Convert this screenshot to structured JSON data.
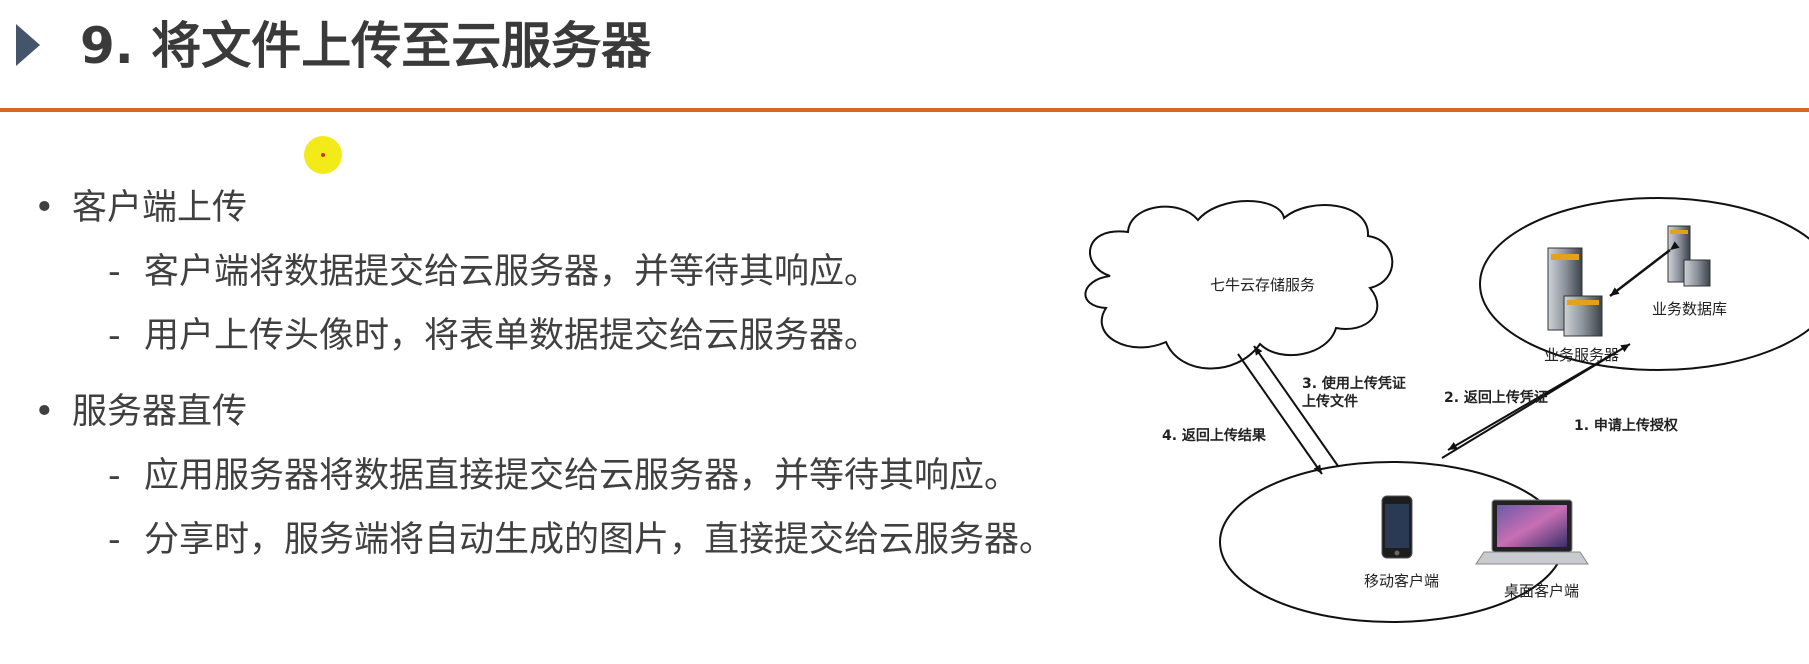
{
  "title": "9. 将文件上传至云服务器",
  "colors": {
    "accent_rule": "#d9651f",
    "marker": "#44546a",
    "pointer": "#f3ea1a"
  },
  "bullets": [
    {
      "label": "客户端上传",
      "subs": [
        "客户端将数据提交给云服务器，并等待其响应。",
        "用户上传头像时，将表单数据提交给云服务器。"
      ]
    },
    {
      "label": "服务器直传",
      "subs": [
        "应用服务器将数据直接提交给云服务器，并等待其响应。",
        "分享时，服务端将自动生成的图片，直接提交给云服务器。"
      ]
    }
  ],
  "diagram": {
    "cloud_label": "七牛云存储服务",
    "server_label": "业务服务器",
    "db_label": "业务数据库",
    "mobile_label": "移动客户端",
    "desktop_label": "桌面客户端",
    "step1": "1. 申请上传授权",
    "step2": "2. 返回上传凭证",
    "step3_line1": "3. 使用上传凭证",
    "step3_line2": "上传文件",
    "step4": "4. 返回上传结果"
  }
}
